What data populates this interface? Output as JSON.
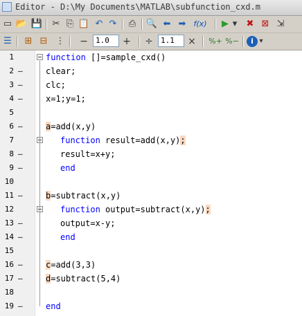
{
  "window": {
    "title": "Editor - D:\\My Documents\\MATLAB\\subfunction_cxd.m"
  },
  "toolbar1": {
    "icons": [
      "new-file-icon",
      "open-folder-icon",
      "save-icon",
      "cut-icon",
      "copy-icon",
      "paste-icon",
      "undo-icon",
      "redo-icon",
      "print-icon",
      "find-icon",
      "back-icon",
      "forward-icon",
      "function-icon",
      "run-icon",
      "run-dropdown-icon",
      "stop-debug-icon",
      "clear-breakpoints-icon",
      "step-in-icon"
    ],
    "fx_label": "f(x)",
    "glyphs": {
      "new": "▭",
      "open": "📂",
      "save": "💾",
      "cut": "✂",
      "copy": "⎘",
      "paste": "📋",
      "undo": "↶",
      "redo": "↷",
      "print": "⎙",
      "find": "🔍",
      "back": "⬅",
      "forward": "➡",
      "run": "▶",
      "dropdown": "▾",
      "stop": "✖",
      "clear": "⊠",
      "step": "⇲"
    }
  },
  "toolbar2": {
    "cell_minus": "−",
    "cell_value_1": "1.0",
    "cell_plus": "+",
    "divide": "÷",
    "cell_value_2": "1.1",
    "times": "×",
    "pct_plus": "%+",
    "pct_minus": "%−",
    "info": "i"
  },
  "editor": {
    "lines": [
      {
        "num": "1",
        "dash": "",
        "indent": 0,
        "pre": "",
        "kw": "function",
        "rest": " []=sample_cxd()",
        "fold": true
      },
      {
        "num": "2",
        "dash": "—",
        "indent": 0,
        "pre": "",
        "kw": "",
        "rest": "clear;"
      },
      {
        "num": "3",
        "dash": "—",
        "indent": 0,
        "pre": "",
        "kw": "",
        "rest": "clc;"
      },
      {
        "num": "4",
        "dash": "—",
        "indent": 0,
        "pre": "",
        "kw": "",
        "rest": "x=1;y=1;"
      },
      {
        "num": "5",
        "dash": "",
        "indent": 0,
        "pre": "",
        "kw": "",
        "rest": ""
      },
      {
        "num": "6",
        "dash": "—",
        "indent": 0,
        "hl": "a",
        "rest": "=add(x,y)"
      },
      {
        "num": "7",
        "dash": "",
        "indent": 1,
        "pre": "",
        "kw": "function",
        "rest": " result=add(x,y)",
        "hlsuffix": ";",
        "fold": true
      },
      {
        "num": "8",
        "dash": "—",
        "indent": 1,
        "pre": "",
        "kw": "",
        "rest": "result=x+y;"
      },
      {
        "num": "9",
        "dash": "—",
        "indent": 1,
        "pre": "",
        "kw": "end",
        "rest": ""
      },
      {
        "num": "10",
        "dash": "",
        "indent": 0,
        "pre": "",
        "kw": "",
        "rest": ""
      },
      {
        "num": "11",
        "dash": "—",
        "indent": 0,
        "hl": "b",
        "rest": "=subtract(x,y)"
      },
      {
        "num": "12",
        "dash": "",
        "indent": 1,
        "pre": "",
        "kw": "function",
        "rest": " output=subtract(x,y)",
        "hlsuffix": ";",
        "fold": true
      },
      {
        "num": "13",
        "dash": "—",
        "indent": 1,
        "pre": "",
        "kw": "",
        "rest": "output=x-y;"
      },
      {
        "num": "14",
        "dash": "—",
        "indent": 1,
        "pre": "",
        "kw": "end",
        "rest": ""
      },
      {
        "num": "15",
        "dash": "",
        "indent": 0,
        "pre": "",
        "kw": "",
        "rest": ""
      },
      {
        "num": "16",
        "dash": "—",
        "indent": 0,
        "hl": "c",
        "rest": "=add(3,3)"
      },
      {
        "num": "17",
        "dash": "—",
        "indent": 0,
        "hl": "d",
        "rest": "=subtract(5,4)"
      },
      {
        "num": "18",
        "dash": "",
        "indent": 0,
        "pre": "",
        "kw": "",
        "rest": ""
      },
      {
        "num": "19",
        "dash": "—",
        "indent": 0,
        "pre": "",
        "kw": "end",
        "rest": ""
      }
    ]
  },
  "colors": {
    "keyword": "#0000ff",
    "highlight": "#f8d8c0"
  }
}
